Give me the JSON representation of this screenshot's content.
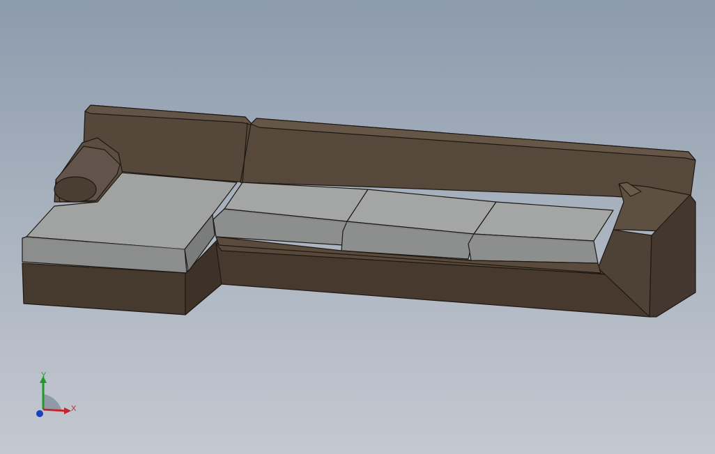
{
  "viewport": {
    "background_top": "#8c9bad",
    "background_bottom": "#c4c8d0"
  },
  "model": {
    "name": "sectional-sofa",
    "frame_color": "#4f4236",
    "frame_dark": "#3f342b",
    "cushion_color": "#8f9090",
    "cushion_top": "#a3a4a4",
    "edge_color": "#1e1812"
  },
  "triad": {
    "x_label": "X",
    "y_label": "Y",
    "x_color": "#c0272d",
    "y_color": "#1f9a2a",
    "z_color": "#1b3fbf"
  }
}
